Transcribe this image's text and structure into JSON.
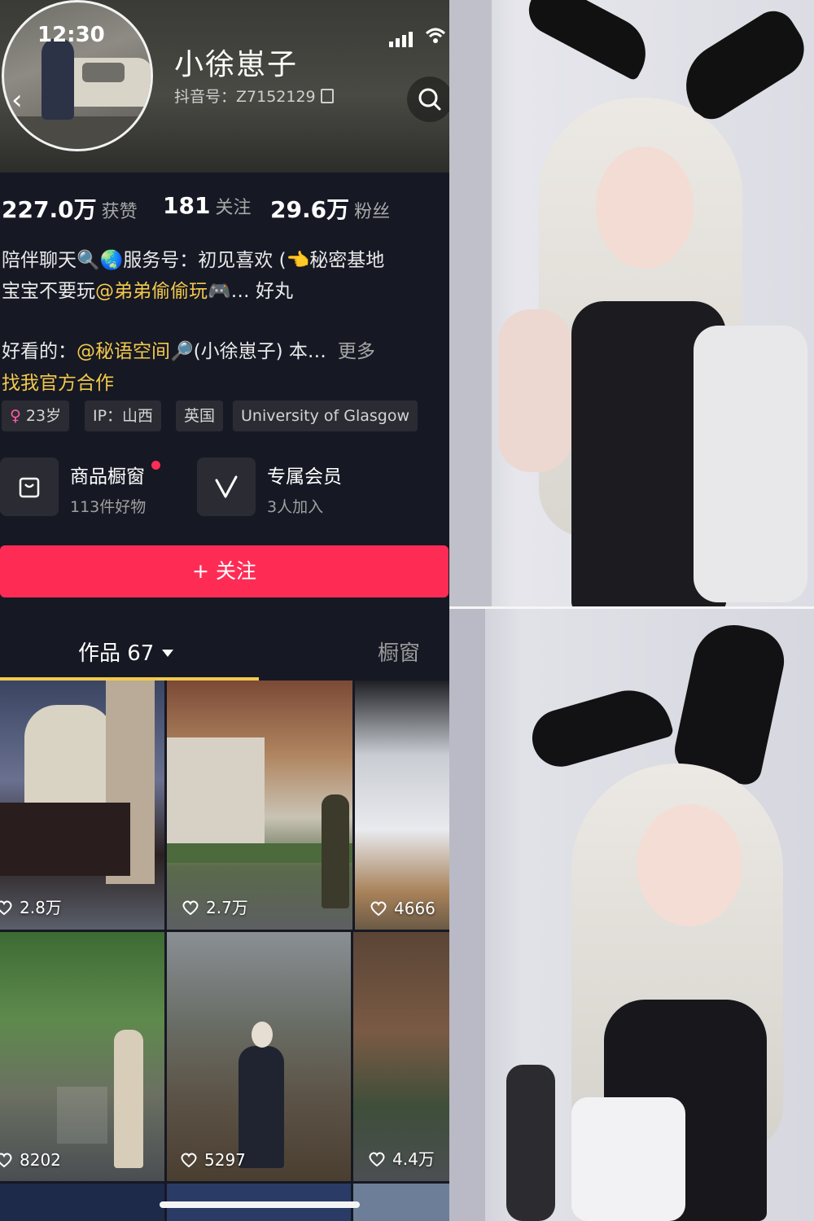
{
  "status_bar": {
    "time": "12:30"
  },
  "profile": {
    "name": "小徐崽子",
    "douyin_id": "抖音号：Z7152129"
  },
  "stats": [
    {
      "value": "227.0万",
      "label": "获赞"
    },
    {
      "value": "181",
      "label": "关注"
    },
    {
      "value": "29.6万",
      "label": "粉丝"
    }
  ],
  "bio": {
    "line1": "陪伴聊天🔍🌏服务号：初见喜欢 (👈秘密基地",
    "line2_prefix": "宝宝不要玩",
    "line2_mention": "@弟弟偷偷玩",
    "line2_suffix": "🎮… 好丸",
    "line3_prefix": "好看的：",
    "line3_mention": "@秘语空间",
    "line3_suffix": "🔎(小徐崽子) 本…",
    "more": "更多",
    "official": "找我官方合作"
  },
  "tags": {
    "age_symbol": "♀",
    "age": "23岁",
    "ip": "IP：山西",
    "country": "英国",
    "school": "University of Glasgow"
  },
  "features": [
    {
      "title": "商品橱窗",
      "subtitle": "113件好物"
    },
    {
      "title": "专属会员",
      "subtitle": "3人加入"
    }
  ],
  "follow_button": "+ 关注",
  "tabs": {
    "works": "作品 67",
    "shop": "橱窗"
  },
  "videos": [
    {
      "likes": "2.8万"
    },
    {
      "likes": "2.7万"
    },
    {
      "likes": "4666"
    },
    {
      "likes": "8202"
    },
    {
      "likes": "5297"
    },
    {
      "likes": "4.4万"
    }
  ],
  "colors": {
    "accent": "#fe2c55",
    "mention": "#f2c94c",
    "background": "#161823"
  }
}
